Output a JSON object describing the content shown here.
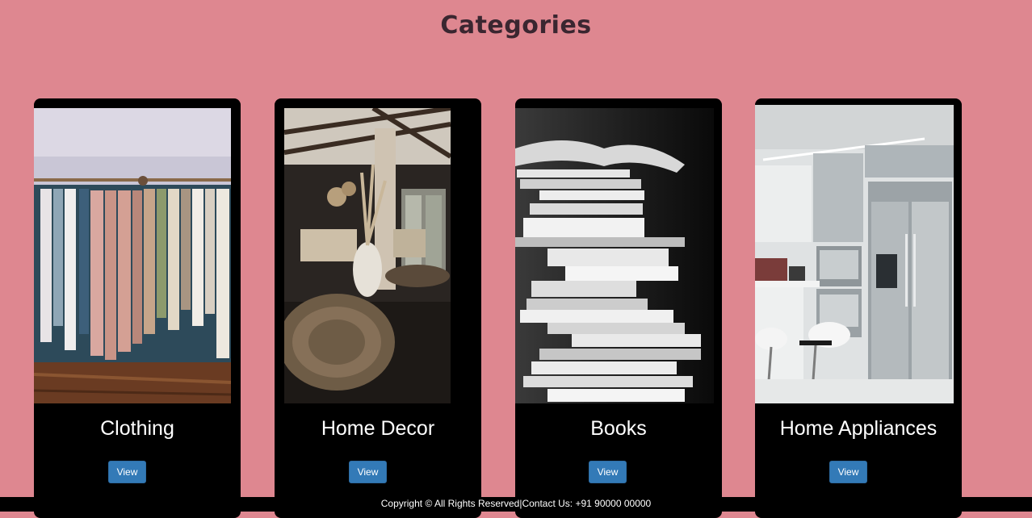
{
  "page": {
    "title": "Categories"
  },
  "categories": [
    {
      "name": "Clothing",
      "button_label": "View",
      "image_icon": "clothing-rack-photo"
    },
    {
      "name": "Home Decor",
      "button_label": "View",
      "image_icon": "living-room-photo"
    },
    {
      "name": "Books",
      "button_label": "View",
      "image_icon": "book-stack-photo"
    },
    {
      "name": "Home Appliances",
      "button_label": "View",
      "image_icon": "kitchen-appliances-photo"
    }
  ],
  "footer": {
    "text": "Copyright © All Rights Reserved|Contact Us: +91 90000 00000"
  },
  "colors": {
    "background": "#de8790",
    "card": "#000000",
    "button": "#337ab7",
    "title": "#3a2630"
  }
}
